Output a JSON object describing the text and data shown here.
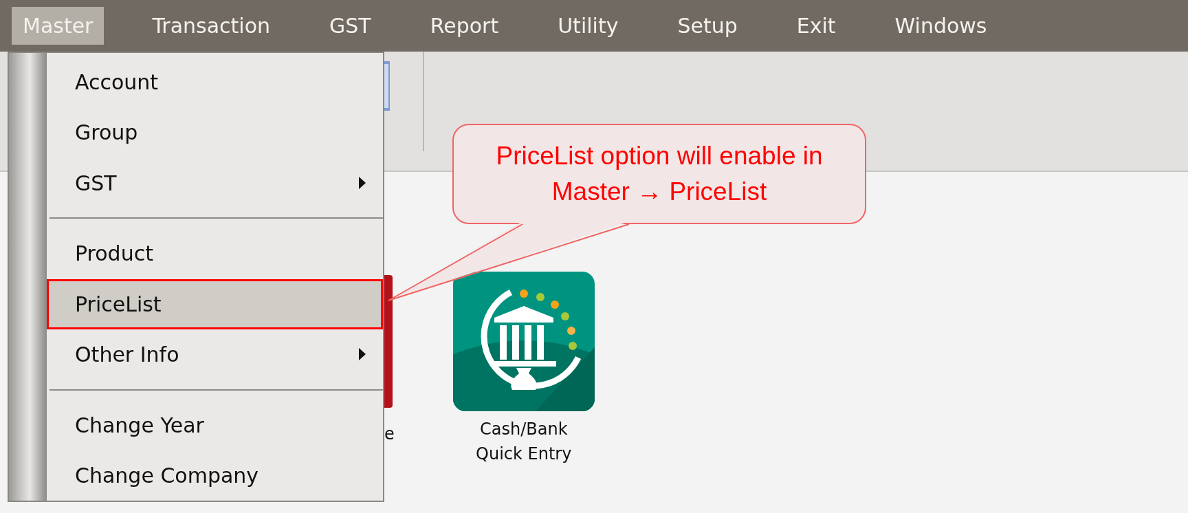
{
  "menu_bar": [
    {
      "label": "Master",
      "selected": true
    },
    {
      "label": "Transaction",
      "selected": false
    },
    {
      "label": "GST",
      "selected": false
    },
    {
      "label": "Report",
      "selected": false
    },
    {
      "label": "Utility",
      "selected": false
    },
    {
      "label": "Setup",
      "selected": false
    },
    {
      "label": "Exit",
      "selected": false
    },
    {
      "label": "Windows",
      "selected": false
    }
  ],
  "dropdown": [
    {
      "kind": "item",
      "label": "Account",
      "has_submenu": false,
      "selected": false
    },
    {
      "kind": "item",
      "label": "Group",
      "has_submenu": false,
      "selected": false
    },
    {
      "kind": "item",
      "label": "GST",
      "has_submenu": true,
      "selected": false
    },
    {
      "kind": "separator"
    },
    {
      "kind": "item",
      "label": "Product",
      "has_submenu": false,
      "selected": false
    },
    {
      "kind": "item",
      "label": "PriceList",
      "has_submenu": false,
      "selected": true
    },
    {
      "kind": "item",
      "label": "Other Info",
      "has_submenu": true,
      "selected": false
    },
    {
      "kind": "separator"
    },
    {
      "kind": "item",
      "label": "Change Year",
      "has_submenu": false,
      "selected": false
    },
    {
      "kind": "item",
      "label": "Change Company",
      "has_submenu": false,
      "selected": false
    }
  ],
  "desktop_icons": [
    {
      "kind": "partial",
      "label": "e"
    },
    {
      "kind": "bank",
      "label": "Cash/Bank Quick Entry"
    }
  ],
  "callout": {
    "line_1": "PriceList option will enable in",
    "separator": "→",
    "path": [
      {
        "label": "Master"
      },
      {
        "label": "PriceList"
      }
    ]
  }
}
